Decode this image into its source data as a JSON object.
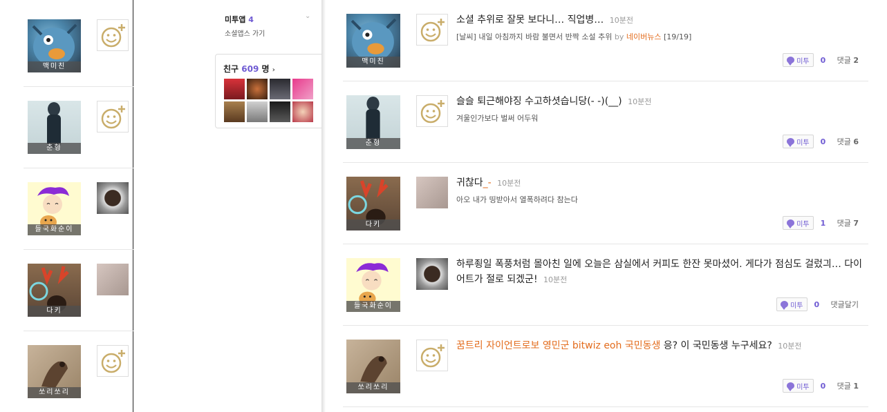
{
  "left": {
    "rows": [
      {
        "name": "맥미친",
        "thumb": "smile"
      },
      {
        "name": "춘형",
        "thumb": "smile"
      },
      {
        "name": "들국화순이",
        "thumb": "coffee-photo"
      },
      {
        "name": "다키",
        "thumb": "cat-photo"
      },
      {
        "name": "쏘리쏘리",
        "thumb": "smile"
      }
    ]
  },
  "middle": {
    "app_title": "미투앱",
    "app_count": "4",
    "app_link": "소셜앱스 가기",
    "friends_label": "친구",
    "friends_count": "609",
    "friends_unit": "명"
  },
  "feed": {
    "posts": [
      {
        "author": "맥미친",
        "title": "소셜 추위로 잘못 보다니… 직업병…",
        "time": "10분전",
        "sub_text": "[날씨] 내일 아침까지 바람 불면서 반짝 소설 추위",
        "sub_by": "by",
        "sub_source": "네이버뉴스",
        "sub_page": "[19/19]",
        "metoo_label": "미투",
        "metoo_count": "0",
        "comment_label": "댓글",
        "comment_count": "2"
      },
      {
        "author": "춘형",
        "title": "슬슬 퇴근해야징 수고하셧습니당(- -)(__)",
        "time": "10분전",
        "sub_text": "겨울인가보다 벌써 어두워",
        "metoo_label": "미투",
        "metoo_count": "0",
        "comment_label": "댓글",
        "comment_count": "6"
      },
      {
        "author": "다키",
        "title_main": "귀찮다",
        "title_deco": "_-",
        "time": "10분전",
        "sub_text": "아오 내가 띵받아서 열폭하려다 참는다",
        "metoo_label": "미투",
        "metoo_count": "1",
        "comment_label": "댓글",
        "comment_count": "7"
      },
      {
        "author": "들국화순이",
        "title": "하루죙일 폭풍처럼 몰아친 일에 오늘은 삼실에서 커피도 한잔 못마셨어. 게다가 점심도 걸렀긔… 다이어트가 절로 되겠군!",
        "time": "10분전",
        "metoo_label": "미투",
        "metoo_count": "0",
        "comment_label": "댓글달기"
      },
      {
        "author": "쏘리쏘리",
        "title_links": "꿈트리 자이언트로보 영민군 bitwiz eoh 국민동생",
        "title_rest": "응? 이 국민동생 누구세요?",
        "time": "10분전",
        "metoo_label": "미투",
        "metoo_count": "0",
        "comment_label": "댓글",
        "comment_count": "1"
      }
    ]
  },
  "colors": {
    "accent_purple": "#6f5bd3",
    "link_orange": "#e36c1d",
    "smile_gold": "#c9ad6a"
  }
}
